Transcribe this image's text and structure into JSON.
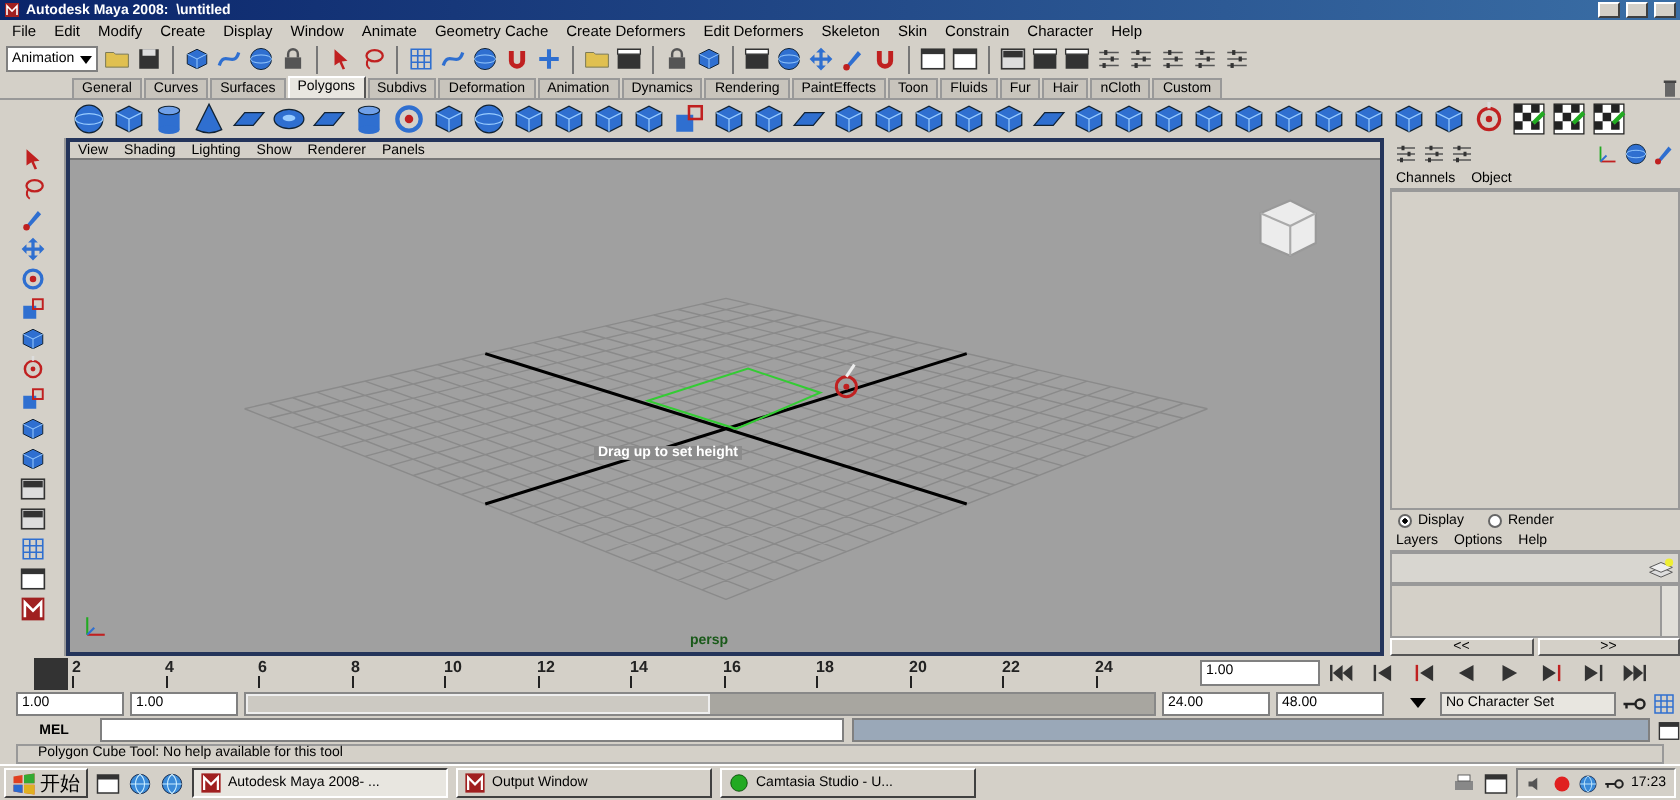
{
  "window": {
    "title": "Autodesk Maya 2008:  \\untitled"
  },
  "menu_bar": [
    "File",
    "Edit",
    "Modify",
    "Create",
    "Display",
    "Window",
    "Animate",
    "Geometry Cache",
    "Create Deformers",
    "Edit Deformers",
    "Skeleton",
    "Skin",
    "Constrain",
    "Character",
    "Help"
  ],
  "status_line": {
    "menu_set": "Animation"
  },
  "shelf": {
    "tabs": [
      {
        "label": "General",
        "selected": false
      },
      {
        "label": "Curves",
        "selected": false
      },
      {
        "label": "Surfaces",
        "selected": false
      },
      {
        "label": "Polygons",
        "selected": true
      },
      {
        "label": "Subdivs",
        "selected": false
      },
      {
        "label": "Deformation",
        "selected": false
      },
      {
        "label": "Animation",
        "selected": false
      },
      {
        "label": "Dynamics",
        "selected": false
      },
      {
        "label": "Rendering",
        "selected": false
      },
      {
        "label": "PaintEffects",
        "selected": false
      },
      {
        "label": "Toon",
        "selected": false
      },
      {
        "label": "Fluids",
        "selected": false
      },
      {
        "label": "Fur",
        "selected": false
      },
      {
        "label": "Hair",
        "selected": false
      },
      {
        "label": "nCloth",
        "selected": false
      },
      {
        "label": "Custom",
        "selected": false
      }
    ]
  },
  "viewport": {
    "menu": [
      "View",
      "Shading",
      "Lighting",
      "Show",
      "Renderer",
      "Panels"
    ],
    "hint": "Drag up to set height",
    "camera": "persp"
  },
  "channel_box": {
    "menu": [
      "Channels",
      "Object"
    ]
  },
  "layer_editor": {
    "modes": [
      {
        "label": "Display",
        "selected": true
      },
      {
        "label": "Render",
        "selected": false
      }
    ],
    "menu": [
      "Layers",
      "Options",
      "Help"
    ],
    "scroll_buttons": [
      "<<",
      ">>"
    ]
  },
  "time_slider": {
    "ticks": [
      "2",
      "4",
      "6",
      "8",
      "10",
      "12",
      "14",
      "16",
      "18",
      "20",
      "22",
      "24"
    ],
    "current_frame": "1.00"
  },
  "range_slider": {
    "level": 0.51,
    "start_time": "1.00",
    "playback_start": "1.00",
    "playback_end": "24.00",
    "end_time": "48.00",
    "character_set": "No Character Set"
  },
  "command_line": {
    "label": "MEL"
  },
  "help_line": "Polygon Cube Tool: No help available for this tool",
  "taskbar": {
    "start": "开始",
    "tasks": [
      {
        "label": "Autodesk Maya 2008- ...",
        "selected": true
      },
      {
        "label": "Output Window",
        "selected": false
      },
      {
        "label": "Camtasia Studio - U...",
        "selected": false
      }
    ],
    "clock": "17:23"
  }
}
